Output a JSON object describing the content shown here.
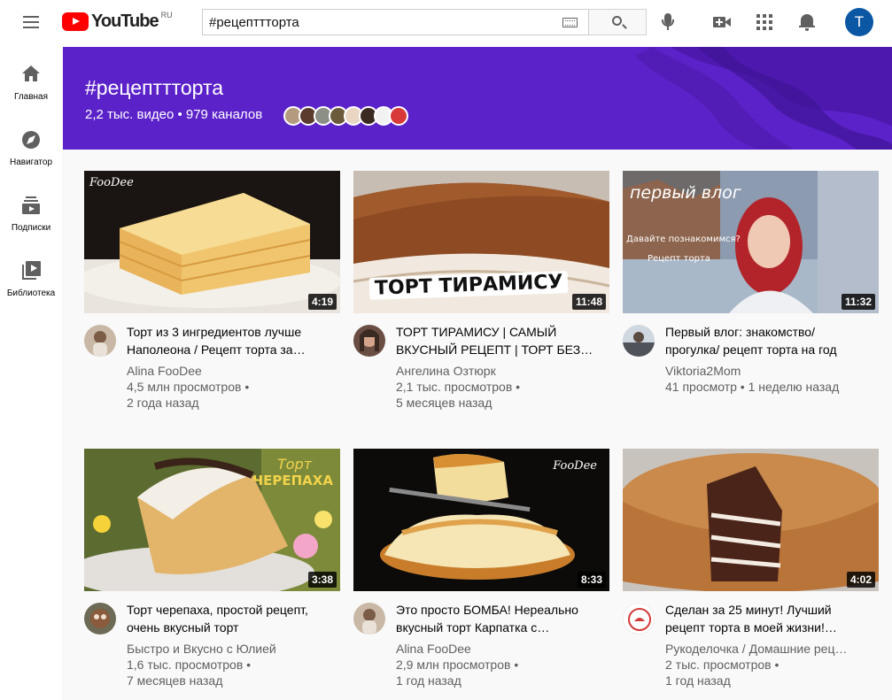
{
  "header": {
    "logo_text": "YouTube",
    "region": "RU",
    "search_value": "#рецепттторта",
    "avatar_letter": "T"
  },
  "sidebar": {
    "items": [
      {
        "label": "Главная",
        "icon": "home-icon"
      },
      {
        "label": "Навигатор",
        "icon": "compass-icon"
      },
      {
        "label": "Подписки",
        "icon": "subscriptions-icon"
      },
      {
        "label": "Библиотека",
        "icon": "library-icon"
      }
    ]
  },
  "banner": {
    "title": "#рецепттторта",
    "stats": "2,2 тыс. видео • 979 каналов",
    "bg_color": "#5b22c9"
  },
  "videos": [
    {
      "title": "Торт из 3 ингредиентов лучше\nНаполеона / Рецепт торта за…",
      "channel": "Alina FooDee",
      "views": "4,5 млн просмотров •",
      "age": "2 года назад",
      "duration": "4:19",
      "watermark": "FooDee"
    },
    {
      "title": "ТОРТ ТИРАМИСУ | САМЫЙ\nВКУСНЫЙ РЕЦЕПТ | ТОРТ БЕЗ…",
      "channel": "Ангелина Озтюрк",
      "views": "2,1 тыс. просмотров •",
      "age": "5 месяцев назад",
      "duration": "11:48",
      "overlay": "ТОРТ ТИРАМИСУ"
    },
    {
      "title": "Первый влог: знакомство/\nпрогулка/ рецепт торта на год",
      "channel": "Viktoria2Mom",
      "views": "41 просмотр • 1 неделю назад",
      "age": "",
      "duration": "11:32",
      "overlay": "первый влог",
      "overlay_sub": "Давайте познакомимся?",
      "overlay_sub2": "Рецепт торта"
    },
    {
      "title": "Торт черепаха, простой рецепт,\nочень вкусный торт",
      "channel": "Быстро и Вкусно с Юлией",
      "views": "1,6 тыс. просмотров •",
      "age": "7 месяцев назад",
      "duration": "3:38",
      "overlay": "Торт",
      "overlay_sub": "ЧЕРЕПАХА"
    },
    {
      "title": "Это просто БОМБА! Нереально\nвкусный торт Карпатка с…",
      "channel": "Alina FooDee",
      "views": "2,9 млн просмотров •",
      "age": "1 год назад",
      "duration": "8:33",
      "watermark": "FooDee"
    },
    {
      "title": "Сделан за 25 минут! Лучший\nрецепт торта в моей жизни!…",
      "channel": "Рукоделочка / Домашние рец…",
      "views": "2 тыс. просмотров •",
      "age": "1 год назад",
      "duration": "4:02"
    }
  ]
}
